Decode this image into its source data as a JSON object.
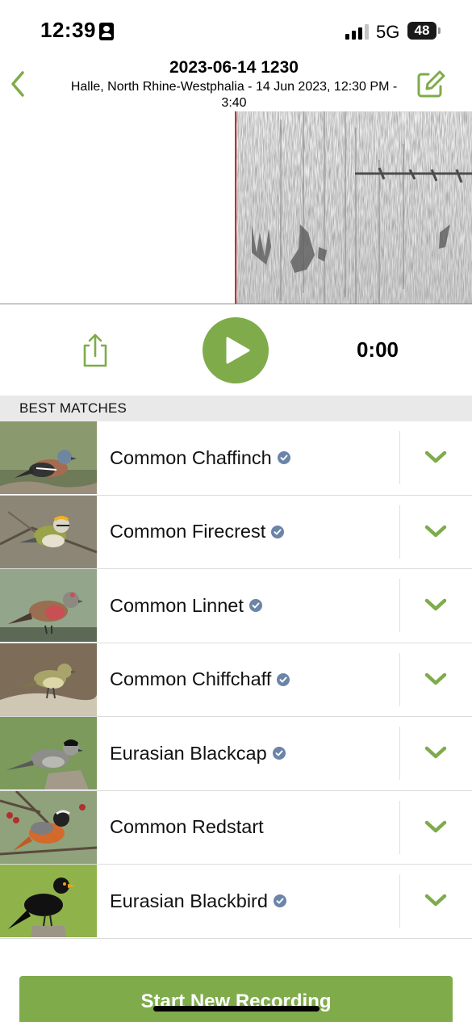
{
  "status_bar": {
    "time": "12:39",
    "network": "5G",
    "battery": "48"
  },
  "header": {
    "title": "2023-06-14 1230",
    "subtitle": "Halle, North Rhine-Westphalia - 14 Jun 2023, 12:30 PM - 3:40"
  },
  "player": {
    "time": "0:00"
  },
  "matches": {
    "section_title": "BEST MATCHES",
    "items": [
      {
        "name": "Common Chaffinch",
        "verified": true
      },
      {
        "name": "Common Firecrest",
        "verified": true
      },
      {
        "name": "Common Linnet",
        "verified": true
      },
      {
        "name": "Common Chiffchaff",
        "verified": true
      },
      {
        "name": "Eurasian Blackcap",
        "verified": true
      },
      {
        "name": "Common Redstart",
        "verified": false
      },
      {
        "name": "Eurasian Blackbird",
        "verified": true
      }
    ]
  },
  "actions": {
    "start_recording": "Start New Recording"
  },
  "colors": {
    "accent": "#7fab4b",
    "verified": "#6b84a8",
    "playhead": "#d62828"
  }
}
